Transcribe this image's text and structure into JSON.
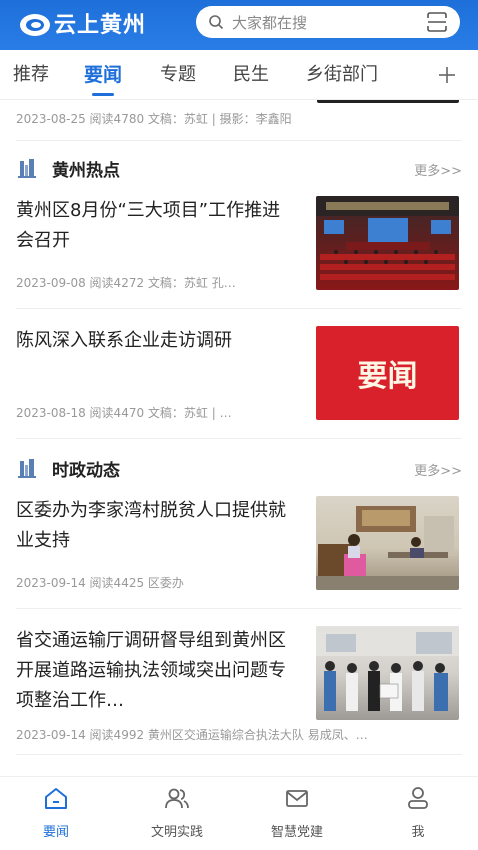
{
  "header": {
    "logo_text": "云上黄州",
    "search_placeholder": "大家都在搜",
    "brand_color": "#1e6fd9"
  },
  "tabs": [
    {
      "label": "推荐",
      "active": false
    },
    {
      "label": "要闻",
      "active": true
    },
    {
      "label": "专题",
      "active": false
    },
    {
      "label": "民生",
      "active": false
    },
    {
      "label": "乡街部门",
      "active": false
    }
  ],
  "add_tab_icon": "plus-icon",
  "top_article_meta": "2023-08-25  阅读4780  文稿：苏虹 | 摄影：李鑫阳",
  "sections": [
    {
      "title": "黄州热点",
      "more": "更多>>",
      "articles": [
        {
          "title": "黄州区8月份“三大项目”工作推进会召开",
          "meta": "2023-09-08  阅读4272  文稿：苏虹  孔…",
          "thumb": "meeting-hall-photo"
        },
        {
          "title": "陈风深入联系企业走访调研",
          "meta": "2023-08-18  阅读4470  文稿：苏虹 | …",
          "thumb": "yaowen-banner",
          "thumb_text": "要闻"
        }
      ]
    },
    {
      "title": "时政动态",
      "more": "更多>>",
      "articles": [
        {
          "title": "区委办为李家湾村脱贫人口提供就业支持",
          "meta": "2023-09-14  阅读4425  区委办",
          "thumb": "office-visit-photo"
        },
        {
          "title": "省交通运输厅调研督导组到黄州区开展道路运输执法领域突出问题专项整治工作…",
          "meta": "2023-09-14  阅读4992  黄州区交通运输综合执法大队  易成凤、…",
          "thumb": "outdoor-group-photo"
        }
      ]
    }
  ],
  "bottom_nav": [
    {
      "label": "要闻",
      "icon": "home-icon",
      "active": true
    },
    {
      "label": "文明实践",
      "icon": "people-icon",
      "active": false
    },
    {
      "label": "智慧党建",
      "icon": "mail-icon",
      "active": false
    },
    {
      "label": "我",
      "icon": "user-icon",
      "active": false
    }
  ]
}
